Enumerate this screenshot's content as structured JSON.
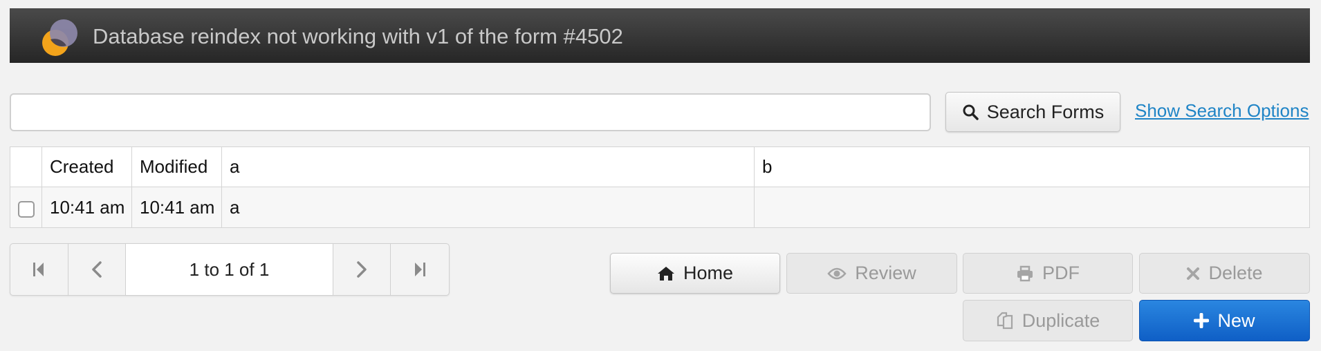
{
  "header": {
    "title": "Database reindex not working with v1 of the form #4502",
    "logo": "overlapping-circles-logo"
  },
  "search": {
    "value": "",
    "button_label": "Search Forms",
    "options_link": "Show Search Options"
  },
  "table": {
    "columns": [
      "",
      "Created",
      "Modified",
      "a",
      "b"
    ],
    "rows": [
      {
        "checked": false,
        "created": "10:41 am",
        "modified": "10:41 am",
        "a": "a",
        "b": ""
      }
    ]
  },
  "pager": {
    "info": "1 to 1 of 1",
    "icons": [
      "first-page-icon",
      "prev-page-icon",
      "next-page-icon",
      "last-page-icon"
    ]
  },
  "actions": {
    "home": "Home",
    "review": "Review",
    "pdf": "PDF",
    "delete": "Delete",
    "duplicate": "Duplicate",
    "new": "New"
  },
  "colors": {
    "header_bg": "#333333",
    "link": "#1f84c6",
    "primary": "#1a6fd4",
    "logo_orange": "#f2a31b",
    "logo_purple": "#8a84a8"
  }
}
